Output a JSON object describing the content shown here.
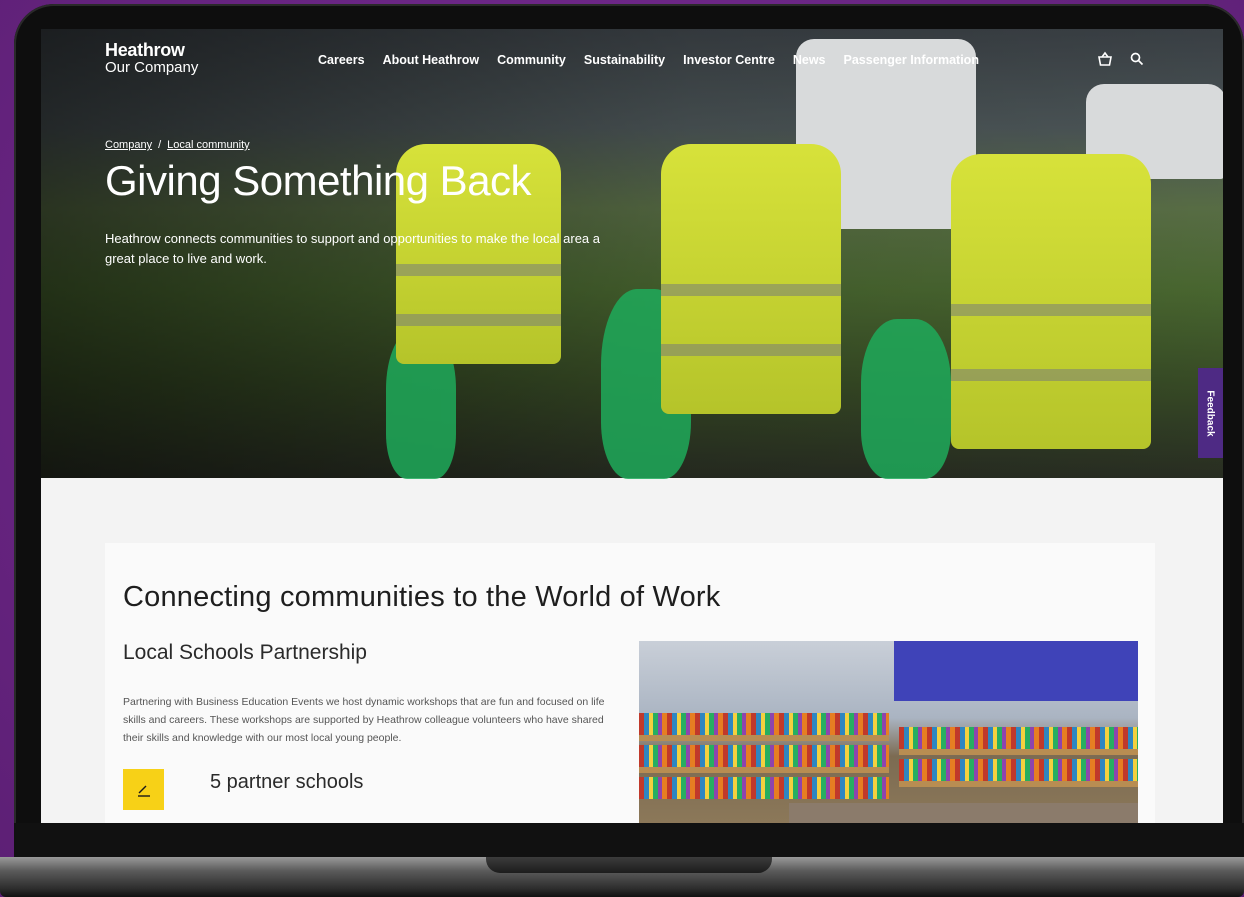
{
  "brand": {
    "name": "Heathrow",
    "subtitle": "Our Company"
  },
  "nav": {
    "items": [
      "Careers",
      "About Heathrow",
      "Community",
      "Sustainability",
      "Investor Centre",
      "News",
      "Passenger Information"
    ],
    "icons": [
      "basket-icon",
      "search-icon"
    ]
  },
  "breadcrumb": {
    "items": [
      "Company",
      "Local community"
    ],
    "separator": "/"
  },
  "hero": {
    "title": "Giving Something Back",
    "description": "Heathrow connects communities to support and opportunities to make the local area a great place to live and work."
  },
  "feedback": {
    "label": "Feedback"
  },
  "section": {
    "title": "Connecting communities to the World of Work",
    "subtitle": "Local Schools Partnership",
    "body": "Partnering with Business Education Events we host dynamic workshops that are fun and focused on life skills and careers. These workshops are supported by Heathrow colleague volunteers who have shared their skills and knowledge with our most local young people.",
    "stat": {
      "icon": "pencil-icon",
      "text": "5 partner schools",
      "icon_color": "#f7d117"
    }
  },
  "colors": {
    "frame_purple": "#6a2585",
    "feedback_purple": "#4e2a84",
    "accent_yellow": "#f7d117"
  }
}
